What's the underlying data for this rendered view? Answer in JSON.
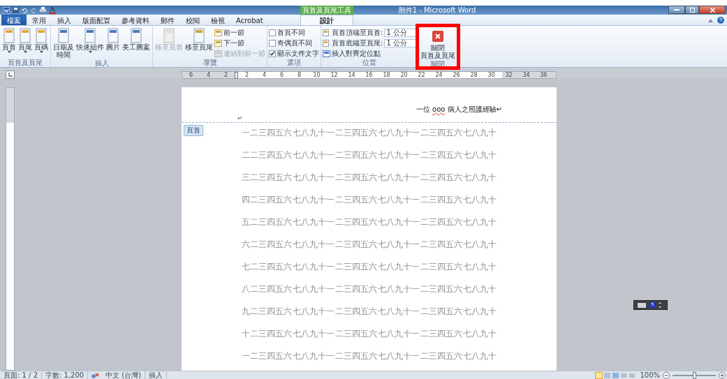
{
  "title_bar": {
    "context_group": "頁首及頁尾工具",
    "title": "附件1 - Microsoft Word"
  },
  "tabs": [
    {
      "label": "檔案",
      "kind": "file",
      "selected": false
    },
    {
      "label": "常用",
      "kind": "normal",
      "selected": false
    },
    {
      "label": "插入",
      "kind": "normal",
      "selected": false
    },
    {
      "label": "版面配置",
      "kind": "normal",
      "selected": false
    },
    {
      "label": "參考資料",
      "kind": "normal",
      "selected": false
    },
    {
      "label": "郵件",
      "kind": "normal",
      "selected": false
    },
    {
      "label": "校閱",
      "kind": "normal",
      "selected": false
    },
    {
      "label": "檢視",
      "kind": "normal",
      "selected": false
    },
    {
      "label": "Acrobat",
      "kind": "normal",
      "selected": false
    },
    {
      "label": "設計",
      "kind": "context",
      "selected": true
    }
  ],
  "ribbon_groups": [
    {
      "name": "頁首及頁尾",
      "items": [
        {
          "kind": "large",
          "lines": [
            "頁首"
          ],
          "dropdown": true,
          "disabled": false
        },
        {
          "kind": "large",
          "lines": [
            "頁尾"
          ],
          "dropdown": true,
          "disabled": false
        },
        {
          "kind": "large",
          "lines": [
            "頁碼"
          ],
          "dropdown": true,
          "disabled": false
        }
      ]
    },
    {
      "name": "插入",
      "items": [
        {
          "kind": "large",
          "lines": [
            "日期及",
            "時間"
          ],
          "dropdown": false,
          "disabled": false
        },
        {
          "kind": "large",
          "lines": [
            "快速組件"
          ],
          "dropdown": true,
          "disabled": false
        },
        {
          "kind": "large",
          "lines": [
            "圖片"
          ],
          "dropdown": false,
          "disabled": false
        },
        {
          "kind": "large",
          "lines": [
            "美工圖案"
          ],
          "dropdown": false,
          "disabled": false
        }
      ]
    },
    {
      "name": "導覽",
      "items": [
        {
          "kind": "large",
          "lines": [
            "移至頁首"
          ],
          "dropdown": false,
          "disabled": true
        },
        {
          "kind": "large",
          "lines": [
            "移至頁尾"
          ],
          "dropdown": false,
          "disabled": false
        },
        {
          "kind": "small",
          "label": "前一節",
          "disabled": false
        },
        {
          "kind": "small",
          "label": "下一節",
          "disabled": false
        },
        {
          "kind": "small",
          "label": "連結到前一節",
          "disabled": true
        }
      ]
    },
    {
      "name": "選項",
      "items": [
        {
          "kind": "check",
          "label": "首頁不同",
          "checked": false
        },
        {
          "kind": "check",
          "label": "奇偶頁不同",
          "checked": false
        },
        {
          "kind": "check",
          "label": "顯示文件文字",
          "checked": true
        }
      ]
    },
    {
      "name": "位置",
      "items": [
        {
          "kind": "spin",
          "label": "頁首頂端至頁首:",
          "value": "1 公分"
        },
        {
          "kind": "spin",
          "label": "頁首底端至頁尾:",
          "value": "1 公分"
        },
        {
          "kind": "small",
          "label": "插入對齊定位點",
          "disabled": false
        }
      ]
    },
    {
      "name": "關閉",
      "items": [
        {
          "kind": "close",
          "lines": [
            "關閉",
            "頁首及頁尾"
          ],
          "disabled": false
        }
      ]
    }
  ],
  "ruler": {
    "left_labels": [
      "6",
      "4",
      "2"
    ],
    "labels": [
      "2",
      "4",
      "6",
      "8",
      "10",
      "12",
      "14",
      "16",
      "18",
      "20",
      "22",
      "24",
      "26",
      "28",
      "30",
      "32",
      "34",
      "36"
    ]
  },
  "document": {
    "header": {
      "before": "一位 ",
      "misspelled": "ooo",
      "after": " 病人之照護經驗",
      "mark": "↵"
    },
    "paragraph_mark": "↵",
    "header_tag": "頁首",
    "lines": [
      "一二三四五六七八九十一二三四五六七八九十一二三四五六七八九十",
      "二二三四五六七八九十一二三四五六七八九十一二三四五六七八九十",
      "三二三四五六七八九十一二三四五六七八九十一二三四五六七八九十",
      "四二三四五六七八九十一二三四五六七八九十一二三四五六七八九十",
      "五二三四五六七八九十一二三四五六七八九十一二三四五六七八九十",
      "六二三四五六七八九十一二三四五六七八九十一二三四五六七八九十",
      "七二三四五六七八九十一二三四五六七八九十一二三四五六七八九十",
      "八二三四五六七八九十一二三四五六七八九十一二三四五六七八九十",
      "九二三四五六七八九十一二三四五六七八九十一二三四五六七八九十",
      "十二三四五六七八九十一二三四五六七八九十一二三四五六七八九十",
      "一二三四五六七八九十一二三四五六七八九十一二三四五六七八九十"
    ]
  },
  "status_bar": {
    "items": [
      "頁面: 1 / 2",
      "字數: 1,200"
    ],
    "language": "中文 (台灣)",
    "mode": "插入",
    "zoom": "100%",
    "zoom_slider": {
      "level": 0.5
    }
  }
}
